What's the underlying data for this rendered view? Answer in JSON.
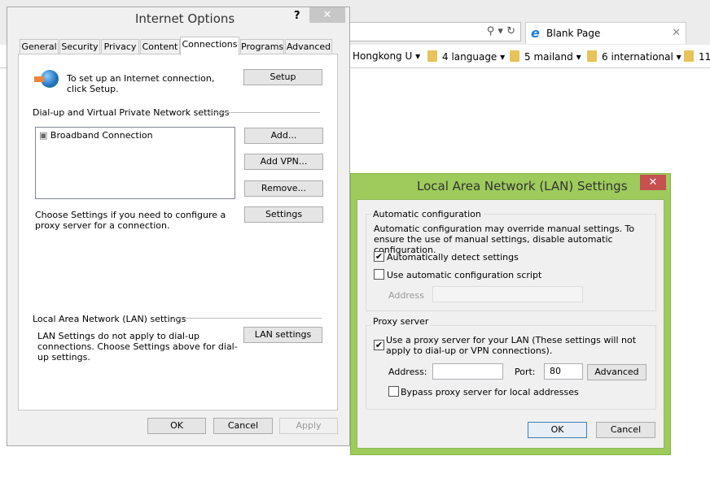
{
  "browser": {
    "tab_title": "Blank Page",
    "favorites": [
      {
        "label": "Hongkong U"
      },
      {
        "label": "4 language"
      },
      {
        "label": "5 mailand"
      },
      {
        "label": "6 international"
      },
      {
        "label": "11"
      }
    ]
  },
  "internet_options": {
    "title": "Internet Options",
    "help": "?",
    "tabs": [
      "General",
      "Security",
      "Privacy",
      "Content",
      "Connections",
      "Programs",
      "Advanced"
    ],
    "selected_tab": "Connections",
    "setup_text": "To set up an Internet connection, click Setup.",
    "setup_button": "Setup",
    "dialup_header": "Dial-up and Virtual Private Network settings",
    "connections": [
      "Broadband Connection"
    ],
    "add_button": "Add...",
    "add_vpn_button": "Add VPN...",
    "remove_button": "Remove...",
    "settings_text": "Choose Settings if you need to configure a proxy server for a connection.",
    "settings_button": "Settings",
    "lan_header": "Local Area Network (LAN) settings",
    "lan_text": "LAN Settings do not apply to dial-up connections. Choose Settings above for dial-up settings.",
    "lan_button": "LAN settings",
    "ok": "OK",
    "cancel": "Cancel",
    "apply": "Apply"
  },
  "lan_dialog": {
    "title": "Local Area Network (LAN) Settings",
    "accent_color": "#9dcb5c",
    "auto_group": "Automatic configuration",
    "auto_text": "Automatic configuration may override manual settings.  To ensure the use of manual settings, disable automatic configuration.",
    "auto_detect": {
      "label": "Automatically detect settings",
      "checked": true
    },
    "auto_script": {
      "label": "Use automatic configuration script",
      "checked": false
    },
    "script_address_label": "Address",
    "script_address_value": "",
    "proxy_group": "Proxy server",
    "use_proxy": {
      "label": "Use a proxy server for your LAN (These settings will not apply to dial-up or VPN connections).",
      "checked": true
    },
    "address_label": "Address:",
    "address_value": "",
    "port_label": "Port:",
    "port_value": "80",
    "advanced_button": "Advanced",
    "bypass": {
      "label": "Bypass proxy server for local addresses",
      "checked": false
    },
    "ok": "OK",
    "cancel": "Cancel"
  }
}
